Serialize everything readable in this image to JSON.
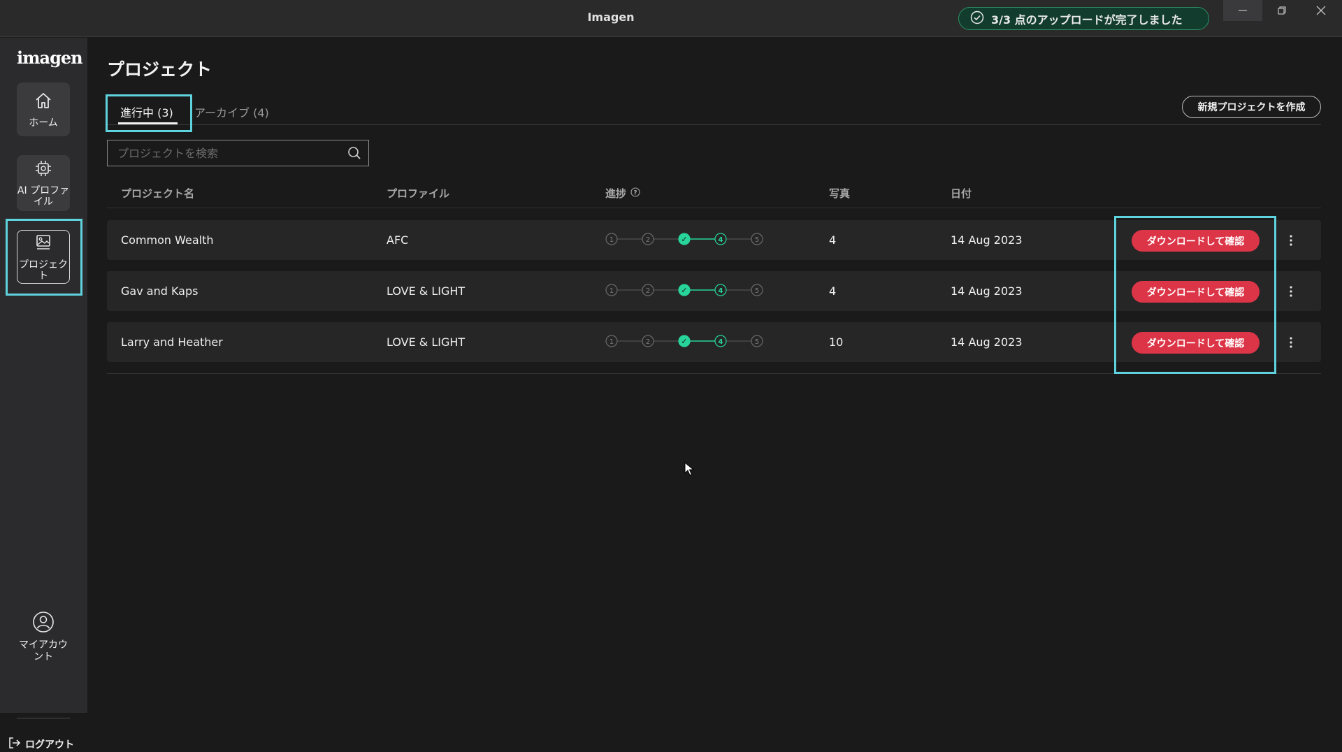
{
  "window": {
    "title": "Imagen"
  },
  "toast": {
    "text": "3/3 点のアップロードが完了しました",
    "color": "#2f8f67"
  },
  "sidebar": {
    "logo": "imagen",
    "items": [
      {
        "label": "ホーム",
        "icon": "home-icon"
      },
      {
        "label": "AI プロファイル",
        "icon": "ai-chip-icon"
      },
      {
        "label": "プロジェクト",
        "icon": "image-icon"
      }
    ],
    "account": {
      "label": "マイアカウント",
      "icon": "user-icon"
    },
    "logout": {
      "label": "ログアウト",
      "icon": "logout-icon"
    }
  },
  "main": {
    "title": "プロジェクト",
    "tabs": [
      {
        "label": "進行中 (3)",
        "active": true
      },
      {
        "label": "アーカイブ (4)",
        "active": false
      }
    ],
    "new_project_label": "新規プロジェクトを作成",
    "search": {
      "placeholder": "プロジェクトを検索",
      "value": ""
    },
    "columns": {
      "name": "プロジェクト名",
      "profile": "プロファイル",
      "progress": "進捗",
      "photos": "写真",
      "date": "日付"
    },
    "rows": [
      {
        "name": "Common Wealth",
        "profile": "AFC",
        "progress_step": 3,
        "photos": "4",
        "date": "14 Aug 2023",
        "action": "ダウンロードして確認"
      },
      {
        "name": "Gav and Kaps",
        "profile": "LOVE & LIGHT",
        "progress_step": 3,
        "photos": "4",
        "date": "14 Aug 2023",
        "action": "ダウンロードして確認"
      },
      {
        "name": "Larry and Heather",
        "profile": "LOVE & LIGHT",
        "progress_step": 3,
        "photos": "10",
        "date": "14 Aug 2023",
        "action": "ダウンロードして確認"
      }
    ],
    "progress_steps": [
      "1",
      "2",
      "✓",
      "4",
      "5"
    ]
  },
  "colors": {
    "accent": "#27d49a",
    "danger": "#dc3547",
    "highlight": "#5ed2dd"
  }
}
